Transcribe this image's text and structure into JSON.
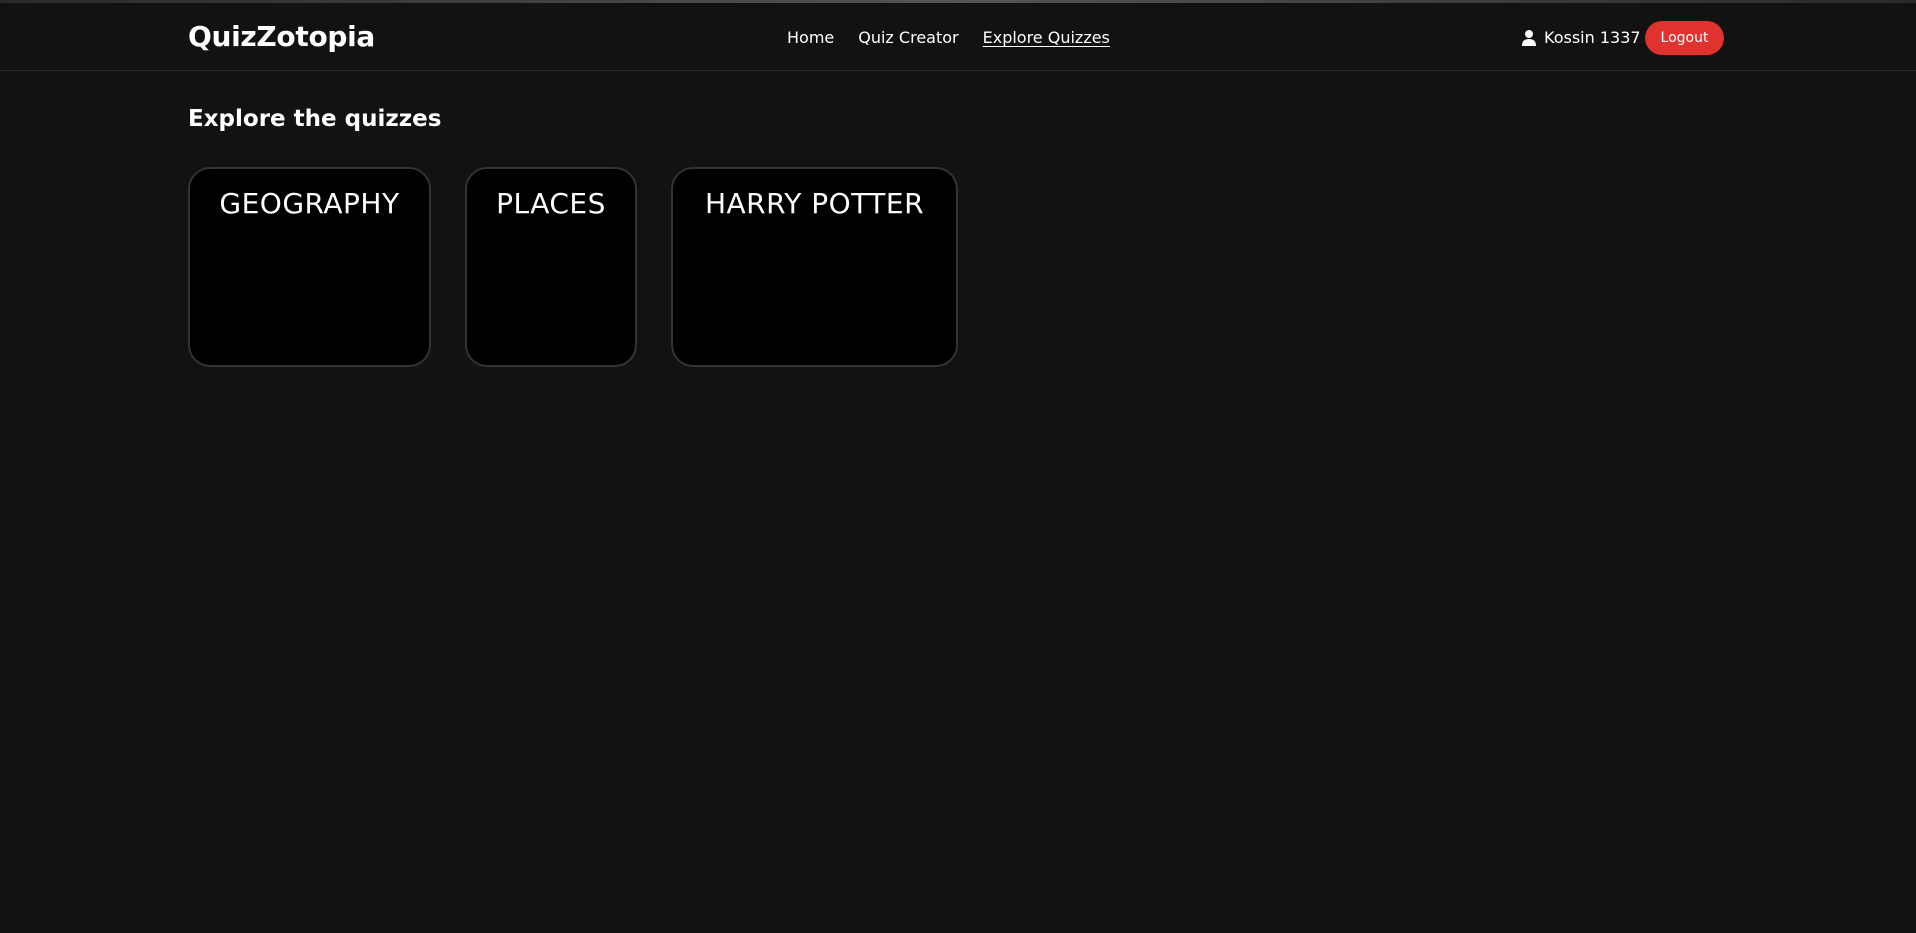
{
  "app": {
    "logo": "QuizZotopia"
  },
  "nav": {
    "items": [
      {
        "label": "Home"
      },
      {
        "label": "Quiz Creator"
      },
      {
        "label": "Explore Quizzes",
        "active": true
      }
    ]
  },
  "user": {
    "icon": "user-icon",
    "name": "Kossin 1337",
    "logout_label": "Logout"
  },
  "main": {
    "title": "Explore the quizzes",
    "quizzes": [
      {
        "title": "GEOGRAPHY"
      },
      {
        "title": "PLACES"
      },
      {
        "title": "HARRY POTTER"
      }
    ]
  },
  "colors": {
    "background": "#121212",
    "card": "#000000",
    "card_border": "#333333",
    "accent": "#e0322f",
    "text": "#ffffff"
  }
}
